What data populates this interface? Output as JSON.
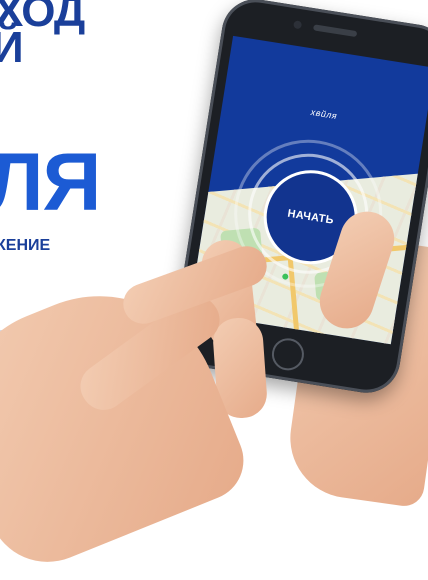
{
  "background": {
    "line1": "ХОД",
    "line2": "Й",
    "brand_fragment": "ЛЯ",
    "subtitle_fragment": "КЕНИЕ"
  },
  "app": {
    "logo_text": "хвйля",
    "start_label": "НАЧАТЬ"
  },
  "colors": {
    "brand_blue": "#1c5bd4",
    "screen_blue": "#123a9c",
    "button_blue": "#12348f"
  }
}
